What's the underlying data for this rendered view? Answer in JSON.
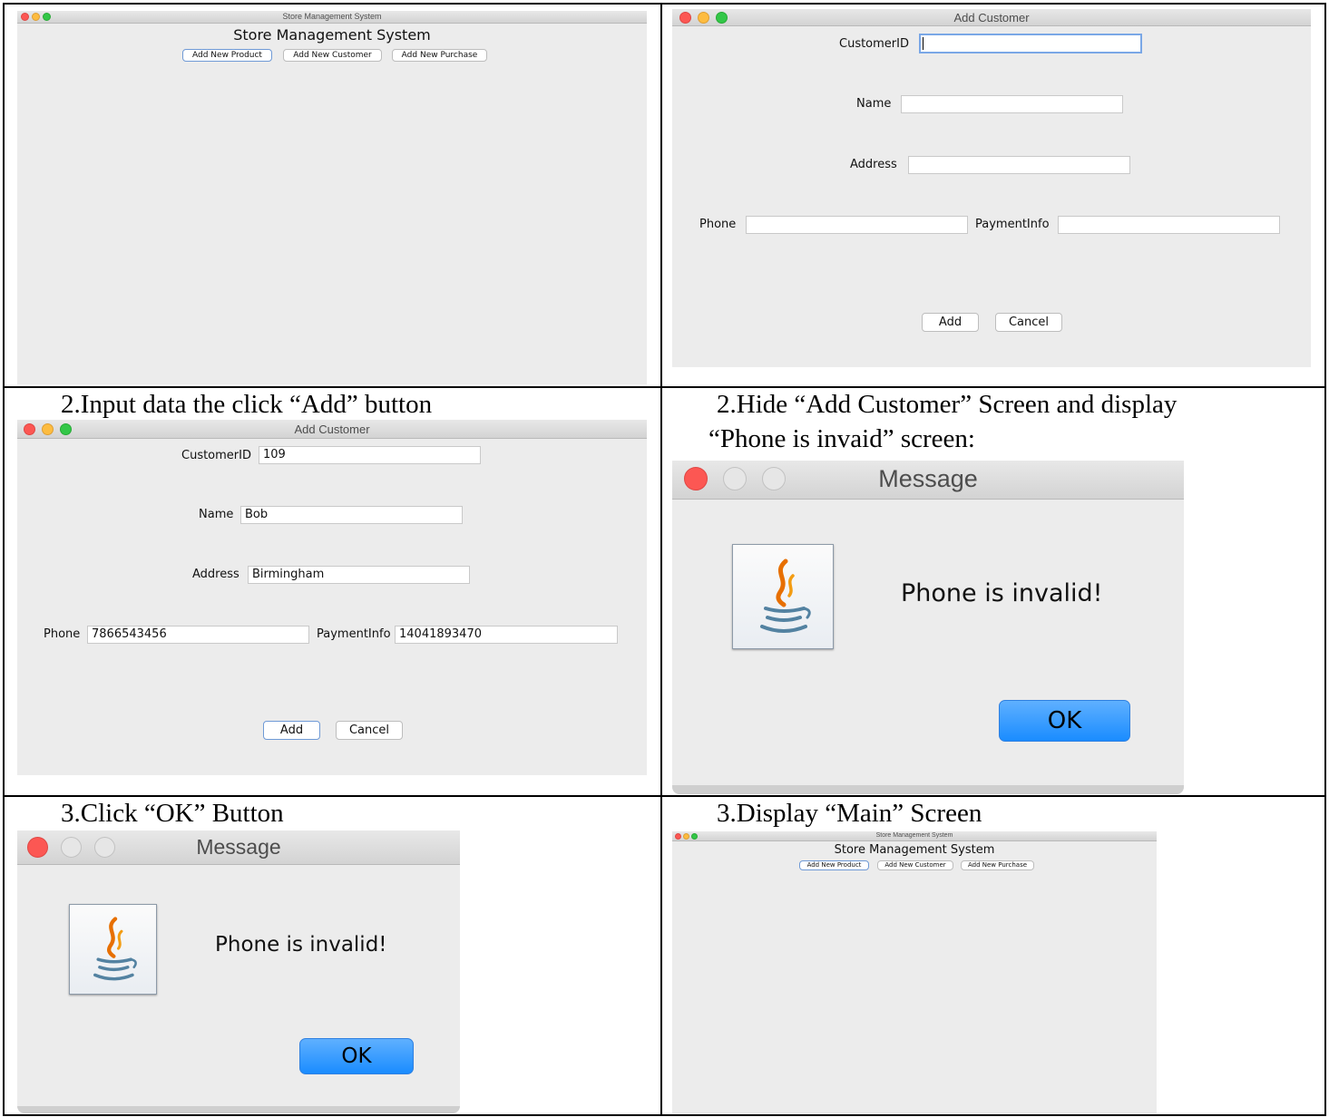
{
  "captions": {
    "row2_left": "2.Input data the click “Add” button",
    "row2_right_line1": "2.Hide “Add Customer” Screen and display",
    "row2_right_line2": "“Phone is invaid” screen:",
    "row3_left": "3.Click “OK” Button",
    "row3_right": "3.Display “Main” Screen"
  },
  "main_window": {
    "title": "Store Management System",
    "heading": "Store Management System",
    "buttons": [
      "Add New Product",
      "Add New Customer",
      "Add New Purchase"
    ]
  },
  "add_customer_window": {
    "title": "Add Customer",
    "labels": {
      "customer_id": "CustomerID",
      "name": "Name",
      "address": "Address",
      "phone": "Phone",
      "payment_info": "PaymentInfo"
    },
    "empty_values": {
      "customer_id": "",
      "name": "",
      "address": "",
      "phone": "",
      "payment_info": ""
    },
    "filled_values": {
      "customer_id": "109",
      "name": "Bob",
      "address": "Birmingham",
      "phone": "7866543456",
      "payment_info": "14041893470"
    },
    "add_label": "Add",
    "cancel_label": "Cancel"
  },
  "message_dialog": {
    "title": "Message",
    "text": "Phone is invalid!",
    "ok_label": "OK",
    "icon": "java-icon"
  },
  "colors": {
    "close": "#fc5753",
    "minimize": "#fdbc40",
    "zoom": "#33c748",
    "ok_button": "#1a8cff"
  }
}
